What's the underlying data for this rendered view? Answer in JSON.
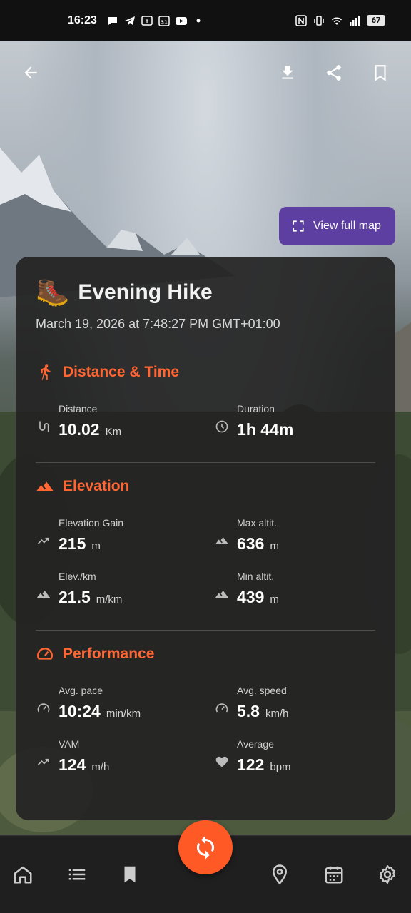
{
  "status_bar": {
    "time": "16:23",
    "battery": "67",
    "left_icons": [
      "chat-icon",
      "telegram-icon",
      "temu-icon",
      "calendar-icon",
      "youtube-icon",
      "dot-icon"
    ],
    "right_icons": [
      "nfc-icon",
      "vibrate-icon",
      "wifi-icon",
      "signal-icon",
      "battery-icon"
    ]
  },
  "top_bar": {
    "back_icon": "arrow-back-icon",
    "actions": [
      "download-icon",
      "share-icon",
      "bookmark-icon"
    ]
  },
  "view_map": {
    "label": "View full map",
    "icon": "fullscreen-icon"
  },
  "activity": {
    "emoji": "🥾",
    "title": "Evening Hike",
    "datetime": "March 19, 2026 at 7:48:27 PM GMT+01:00"
  },
  "sections": {
    "distance_time": {
      "label": "Distance & Time",
      "icon": "runner-icon",
      "metrics": [
        {
          "label": "Distance",
          "value": "10.02",
          "unit": "Km",
          "icon": "route-icon"
        },
        {
          "label": "Duration",
          "value": "1h 44m",
          "unit": "",
          "icon": "clock-icon"
        }
      ]
    },
    "elevation": {
      "label": "Elevation",
      "icon": "mountain-icon",
      "metrics": [
        {
          "label": "Elevation Gain",
          "value": "215",
          "unit": "m",
          "icon": "trending-up-icon"
        },
        {
          "label": "Max altit.",
          "value": "636",
          "unit": "m",
          "icon": "mountain-icon"
        },
        {
          "label": "Elev./km",
          "value": "21.5",
          "unit": "m/km",
          "icon": "mountain-icon"
        },
        {
          "label": "Min altit.",
          "value": "439",
          "unit": "m",
          "icon": "mountain-icon"
        }
      ]
    },
    "performance": {
      "label": "Performance",
      "icon": "speedometer-icon",
      "metrics": [
        {
          "label": "Avg. pace",
          "value": "10:24",
          "unit": "min/km",
          "icon": "speedometer-icon"
        },
        {
          "label": "Avg. speed",
          "value": "5.8",
          "unit": "km/h",
          "icon": "speedometer-icon"
        },
        {
          "label": "VAM",
          "value": "124",
          "unit": "m/h",
          "icon": "trending-up-icon"
        },
        {
          "label": "Average",
          "value": "122",
          "unit": "bpm",
          "icon": "heart-icon"
        }
      ]
    }
  },
  "bottom_nav": {
    "items": [
      "home-icon",
      "list-icon",
      "bookmark-icon",
      "location-icon",
      "calendar-icon",
      "settings-icon"
    ],
    "fab_icon": "sync-icon"
  },
  "colors": {
    "accent": "#ff6633",
    "fab": "#ff5a26",
    "view_map_bg": "#5c3fa1",
    "card_bg": "#242424"
  }
}
